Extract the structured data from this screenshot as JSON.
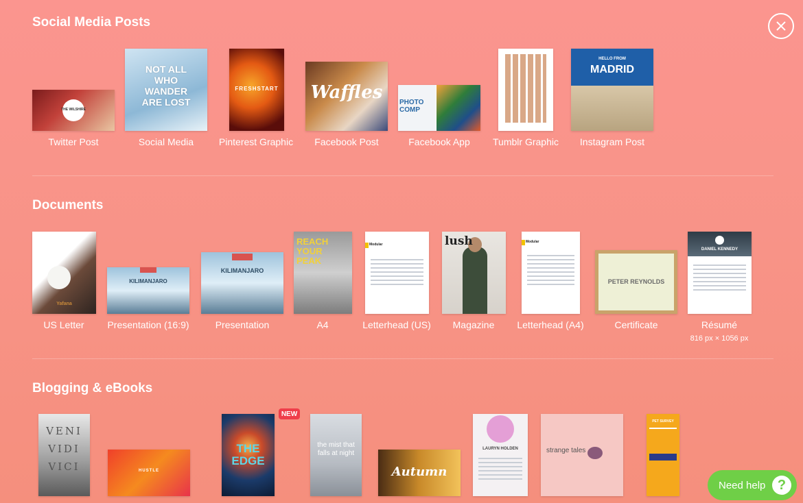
{
  "sections": {
    "social": {
      "title": "Social Media Posts",
      "items": [
        {
          "label": "Twitter Post",
          "thumb_text": "THE WILSHIRE"
        },
        {
          "label": "Social Media",
          "thumb_text": "NOT ALL WHO WANDER ARE LOST"
        },
        {
          "label": "Pinterest Graphic",
          "thumb_text": "FRESHSTART"
        },
        {
          "label": "Facebook Post",
          "thumb_text": "Waffles"
        },
        {
          "label": "Facebook App",
          "thumb_text": "PHOTO COMP"
        },
        {
          "label": "Tumblr Graphic",
          "thumb_text": ""
        },
        {
          "label": "Instagram Post",
          "thumb_text": "MADRID",
          "thumb_sub": "HELLO FROM"
        }
      ]
    },
    "documents": {
      "title": "Documents",
      "items": [
        {
          "label": "US Letter",
          "thumb_text": "Yafana"
        },
        {
          "label": "Presentation (16:9)",
          "thumb_text": "KILIMANJARO"
        },
        {
          "label": "Presentation",
          "thumb_text": "KILIMANJARO"
        },
        {
          "label": "A4",
          "thumb_text": "REACH YOUR PEAK"
        },
        {
          "label": "Letterhead (US)",
          "thumb_text": "Modular"
        },
        {
          "label": "Magazine",
          "thumb_text": "lush"
        },
        {
          "label": "Letterhead (A4)",
          "thumb_text": "Modular"
        },
        {
          "label": "Certificate",
          "thumb_text": "PETER REYNOLDS"
        },
        {
          "label": "Résumé",
          "thumb_text": "DANIEL KENNEDY",
          "sub": "816 px × 1056 px"
        }
      ]
    },
    "blogging": {
      "title": "Blogging & eBooks",
      "new_badge": "NEW",
      "items": [
        {
          "thumb_text": "VENI VIDI VICI"
        },
        {
          "thumb_text": "HUSTLE"
        },
        {
          "thumb_text": "THE EDGE"
        },
        {
          "thumb_text": "the mist that falls at night"
        },
        {
          "thumb_text": "Autumn"
        },
        {
          "thumb_text": "LAURYN HOLDEN"
        },
        {
          "thumb_text": "strange tales"
        },
        {
          "thumb_text": "PET SURVEY"
        }
      ]
    }
  },
  "help": {
    "label": "Need help",
    "icon": "?"
  },
  "close": {
    "icon": "close-icon"
  }
}
